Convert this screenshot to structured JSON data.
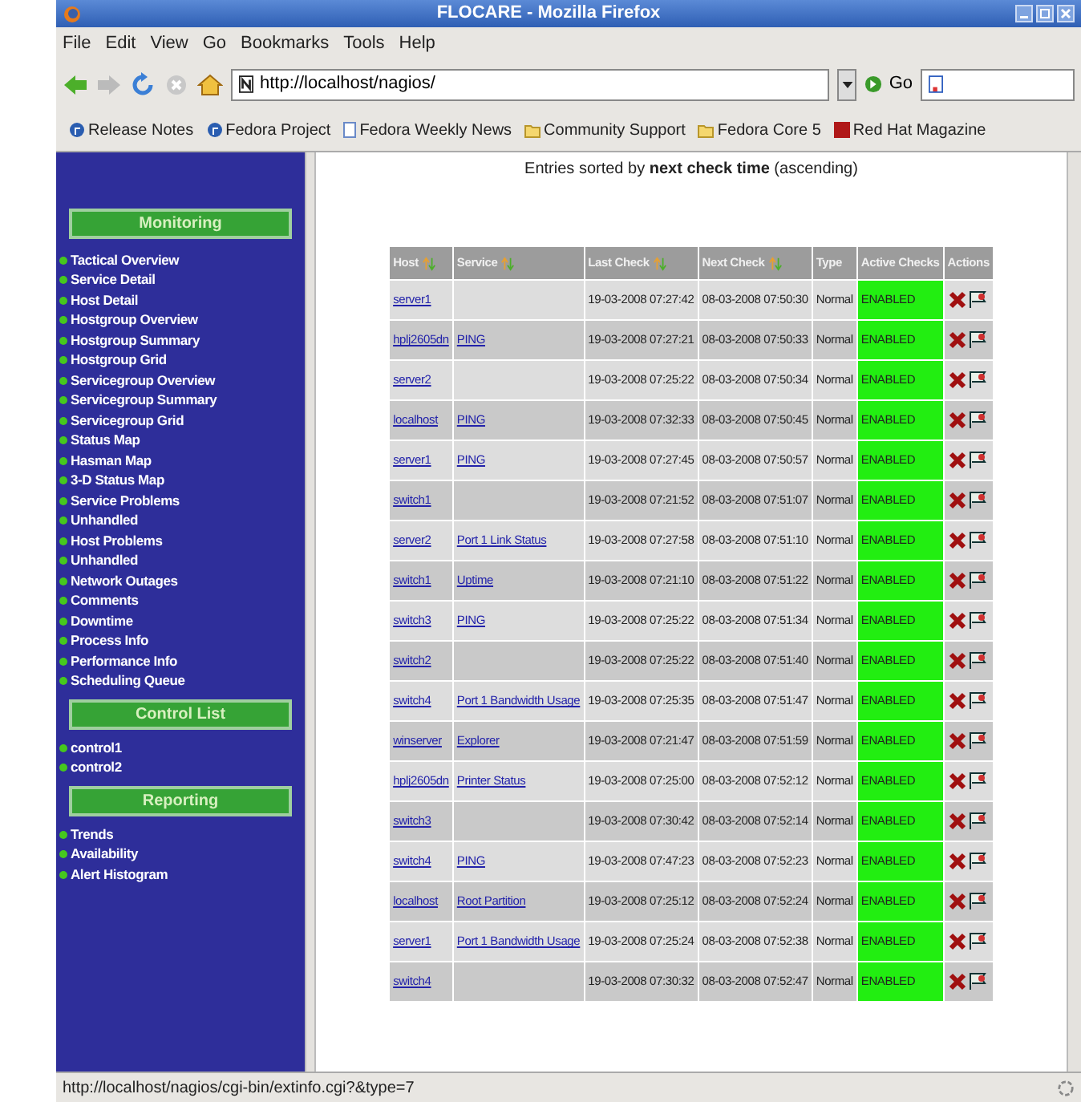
{
  "window": {
    "title": "FLOCARE - Mozilla Firefox"
  },
  "menu": [
    "File",
    "Edit",
    "View",
    "Go",
    "Bookmarks",
    "Tools",
    "Help"
  ],
  "toolbar": {
    "url": "http://localhost/nagios/",
    "go_label": "Go"
  },
  "bookmarks": [
    "Release Notes",
    "Fedora Project",
    "Fedora Weekly News",
    "Community Support",
    "Fedora Core 5",
    "Red Hat Magazine"
  ],
  "sidebar": {
    "sections": [
      {
        "title": "Monitoring",
        "items": [
          "Tactical Overview",
          "Service Detail",
          "Host Detail",
          "Hostgroup Overview",
          "Hostgroup Summary",
          "Hostgroup Grid",
          "Servicegroup Overview",
          "Servicegroup Summary",
          "Servicegroup Grid",
          "Status Map",
          "Hasman Map",
          "3-D Status Map",
          "Service Problems",
          "Unhandled",
          "Host Problems",
          "Unhandled",
          "Network Outages",
          "Comments",
          "Downtime",
          "Process Info",
          "Performance Info",
          "Scheduling Queue"
        ]
      },
      {
        "title": "Control List",
        "items": [
          "control1",
          "control2"
        ]
      },
      {
        "title": "Reporting",
        "items": [
          "Trends",
          "Availability",
          "Alert Histogram"
        ]
      }
    ]
  },
  "main": {
    "caption": "Entries sorted by **next check time** (ascending)"
  },
  "table": {
    "columns": [
      {
        "label": "Host",
        "sortable": true
      },
      {
        "label": "Service",
        "sortable": true
      },
      {
        "label": "Last Check",
        "sortable": true
      },
      {
        "label": "Next Check",
        "sortable": true
      },
      {
        "label": "Type",
        "sortable": false
      },
      {
        "label": "Active Checks",
        "sortable": false
      },
      {
        "label": "Actions",
        "sortable": false
      }
    ],
    "rows": [
      {
        "host": "server1",
        "service": "",
        "last_check": "19-03-2008 07:27:42",
        "next_check": "08-03-2008 07:50:30",
        "type": "Normal",
        "active_checks": "ENABLED"
      },
      {
        "host": "hplj2605dn",
        "service": "PING",
        "last_check": "19-03-2008 07:27:21",
        "next_check": "08-03-2008 07:50:33",
        "type": "Normal",
        "active_checks": "ENABLED"
      },
      {
        "host": "server2",
        "service": "",
        "last_check": "19-03-2008 07:25:22",
        "next_check": "08-03-2008 07:50:34",
        "type": "Normal",
        "active_checks": "ENABLED"
      },
      {
        "host": "localhost",
        "service": "PING",
        "last_check": "19-03-2008 07:32:33",
        "next_check": "08-03-2008 07:50:45",
        "type": "Normal",
        "active_checks": "ENABLED"
      },
      {
        "host": "server1",
        "service": "PING",
        "last_check": "19-03-2008 07:27:45",
        "next_check": "08-03-2008 07:50:57",
        "type": "Normal",
        "active_checks": "ENABLED"
      },
      {
        "host": "switch1",
        "service": "",
        "last_check": "19-03-2008 07:21:52",
        "next_check": "08-03-2008 07:51:07",
        "type": "Normal",
        "active_checks": "ENABLED"
      },
      {
        "host": "server2",
        "service": "Port 1 Link Status",
        "last_check": "19-03-2008 07:27:58",
        "next_check": "08-03-2008 07:51:10",
        "type": "Normal",
        "active_checks": "ENABLED"
      },
      {
        "host": "switch1",
        "service": "Uptime",
        "last_check": "19-03-2008 07:21:10",
        "next_check": "08-03-2008 07:51:22",
        "type": "Normal",
        "active_checks": "ENABLED"
      },
      {
        "host": "switch3",
        "service": "PING",
        "last_check": "19-03-2008 07:25:22",
        "next_check": "08-03-2008 07:51:34",
        "type": "Normal",
        "active_checks": "ENABLED"
      },
      {
        "host": "switch2",
        "service": "",
        "last_check": "19-03-2008 07:25:22",
        "next_check": "08-03-2008 07:51:40",
        "type": "Normal",
        "active_checks": "ENABLED"
      },
      {
        "host": "switch4",
        "service": "Port 1 Bandwidth Usage",
        "last_check": "19-03-2008 07:25:35",
        "next_check": "08-03-2008 07:51:47",
        "type": "Normal",
        "active_checks": "ENABLED"
      },
      {
        "host": "winserver",
        "service": "Explorer",
        "last_check": "19-03-2008 07:21:47",
        "next_check": "08-03-2008 07:51:59",
        "type": "Normal",
        "active_checks": "ENABLED"
      },
      {
        "host": "hplj2605dn",
        "service": "Printer Status",
        "last_check": "19-03-2008 07:25:00",
        "next_check": "08-03-2008 07:52:12",
        "type": "Normal",
        "active_checks": "ENABLED"
      },
      {
        "host": "switch3",
        "service": "",
        "last_check": "19-03-2008 07:30:42",
        "next_check": "08-03-2008 07:52:14",
        "type": "Normal",
        "active_checks": "ENABLED"
      },
      {
        "host": "switch4",
        "service": "PING",
        "last_check": "19-03-2008 07:47:23",
        "next_check": "08-03-2008 07:52:23",
        "type": "Normal",
        "active_checks": "ENABLED"
      },
      {
        "host": "localhost",
        "service": "Root Partition",
        "last_check": "19-03-2008 07:25:12",
        "next_check": "08-03-2008 07:52:24",
        "type": "Normal",
        "active_checks": "ENABLED"
      },
      {
        "host": "server1",
        "service": "Port 1 Bandwidth Usage",
        "last_check": "19-03-2008 07:25:24",
        "next_check": "08-03-2008 07:52:38",
        "type": "Normal",
        "active_checks": "ENABLED"
      },
      {
        "host": "switch4",
        "service": "",
        "last_check": "19-03-2008 07:30:32",
        "next_check": "08-03-2008 07:52:47",
        "type": "Normal",
        "active_checks": "ENABLED"
      }
    ]
  },
  "status_bar": "http://localhost/nagios/cgi-bin/extinfo.cgi?&type=7"
}
